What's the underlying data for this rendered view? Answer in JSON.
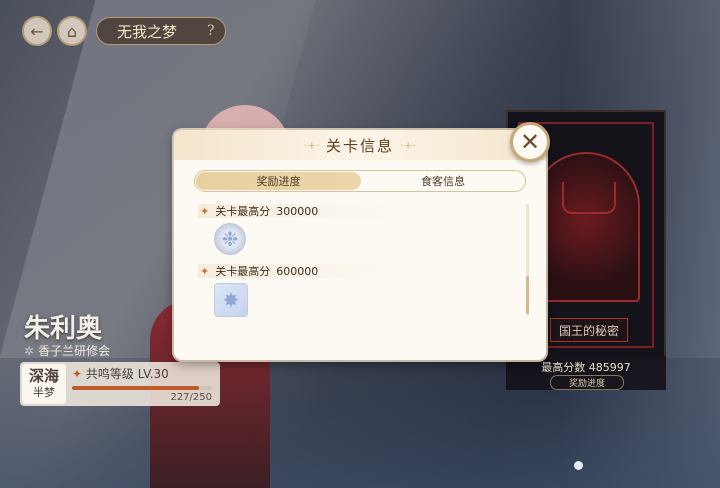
{
  "header": {
    "title": "无我之梦",
    "help": "?",
    "back_icon": "←",
    "home_icon": "⌂"
  },
  "modal": {
    "title": "关卡信息",
    "tabs": [
      {
        "label": "奖励进度",
        "active": true
      },
      {
        "label": "食客信息",
        "active": false
      }
    ],
    "rewards": [
      {
        "label": "关卡最高分",
        "score": "300000",
        "item_icon": "crystal-flower-icon"
      },
      {
        "label": "关卡最高分",
        "score": "600000",
        "item_icon": "star-crystal-icon"
      }
    ],
    "close_icon": "✕"
  },
  "character": {
    "name": "朱利奥",
    "org": "香子兰研修会",
    "badge_line1": "深海",
    "badge_line2": "半梦",
    "level_label": "共鸣等级 LV.30",
    "xp_text": "227/250",
    "xp_fraction": 0.908
  },
  "card": {
    "name": "国王的秘密",
    "score_text": "最高分数 485997",
    "rewards_button": "奖励进度"
  },
  "colors": {
    "accent": "#c05b2e",
    "gold": "#c7a97b"
  }
}
